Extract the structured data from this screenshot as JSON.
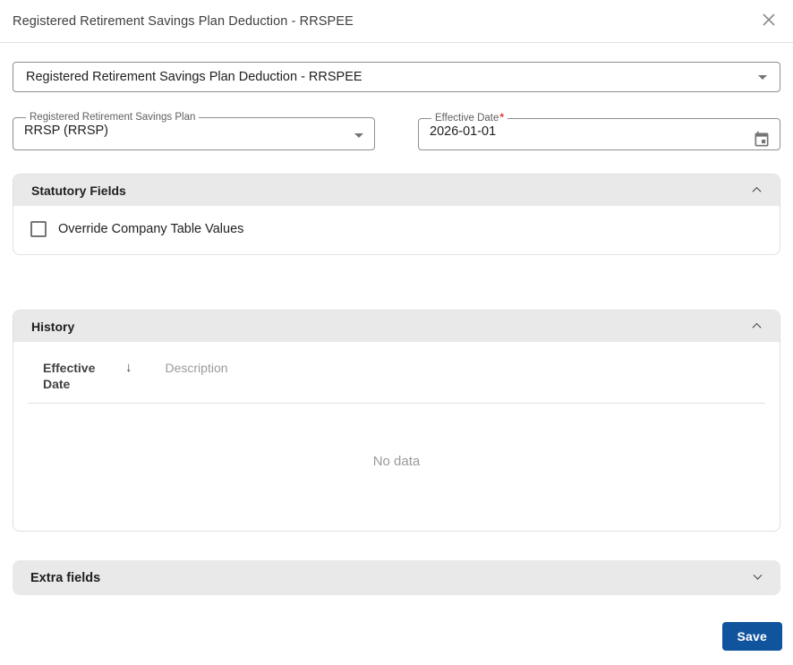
{
  "dialog": {
    "title": "Registered Retirement Savings Plan Deduction - RRSPEE"
  },
  "element_select": {
    "value": "Registered Retirement Savings Plan Deduction - RRSPEE"
  },
  "fields": {
    "plan": {
      "label": "Registered Retirement Savings Plan",
      "value": "RRSP (RRSP)"
    },
    "effective_date": {
      "label": "Effective Date",
      "required_marker": "*",
      "value": "2026-01-01"
    }
  },
  "sections": {
    "statutory": {
      "title": "Statutory Fields",
      "expanded": true,
      "checkbox": {
        "label": "Override Company Table Values",
        "checked": false
      }
    },
    "history": {
      "title": "History",
      "expanded": true,
      "table": {
        "columns": [
          {
            "label": "Effective Date",
            "sorted": "descending"
          },
          {
            "label": "Description"
          }
        ],
        "rows": [],
        "empty_text": "No data"
      }
    },
    "extra": {
      "title": "Extra fields",
      "expanded": false
    }
  },
  "footer": {
    "save_label": "Save"
  },
  "icons": {
    "close": "close-x",
    "sort_descending": "↓",
    "select_caret": "triangle-down",
    "calendar": "event-calendar",
    "collapse": "chevron-up",
    "expand": "chevron-down"
  },
  "colors": {
    "accent_blue": "#11549E",
    "required_red": "#E53935",
    "section_header_bg": "#E9E9E9",
    "border_gray": "#8F8F8F",
    "muted_text": "#9A9A9A"
  }
}
